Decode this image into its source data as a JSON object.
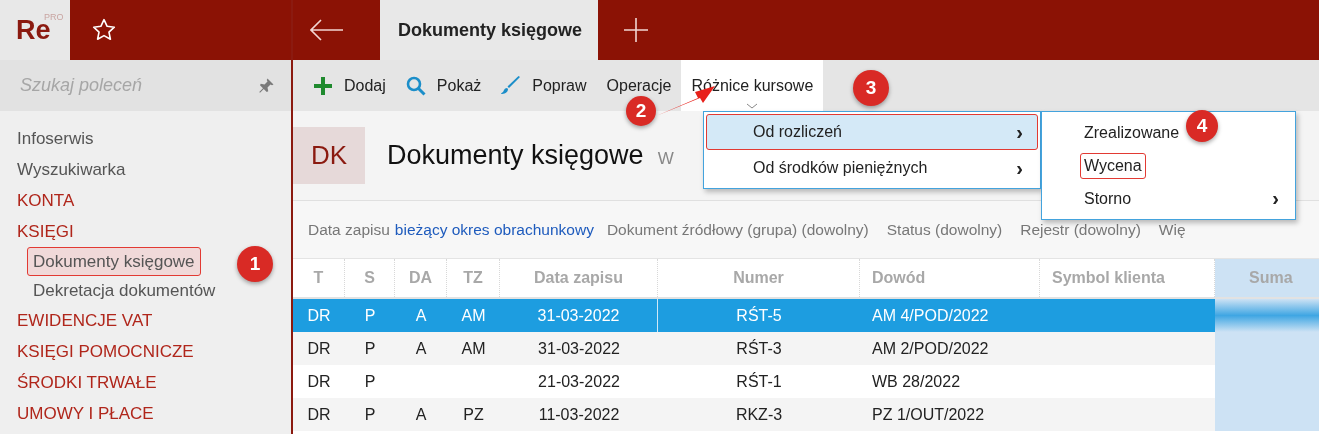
{
  "logo": {
    "text": "Re",
    "badge": "PRO"
  },
  "search": {
    "placeholder": "Szukaj poleceń"
  },
  "sidebar": {
    "items": [
      {
        "label": "Infoserwis",
        "kind": "link"
      },
      {
        "label": "Wyszukiwarka",
        "kind": "link"
      },
      {
        "label": "KONTA",
        "kind": "section"
      },
      {
        "label": "KSIĘGI",
        "kind": "section",
        "children": [
          {
            "label": "Dokumenty księgowe",
            "selected": true,
            "highlighted": true
          },
          {
            "label": "Dekretacja dokumentów",
            "selected": false,
            "highlighted": false
          }
        ]
      },
      {
        "label": "EWIDENCJE VAT",
        "kind": "section"
      },
      {
        "label": "KSIĘGI POMOCNICZE",
        "kind": "section"
      },
      {
        "label": "ŚRODKI TRWAŁE",
        "kind": "section"
      },
      {
        "label": "UMOWY I PŁACE",
        "kind": "section"
      }
    ]
  },
  "tabs": [
    {
      "label": "Dokumenty księgowe",
      "selected": true
    }
  ],
  "toolbar": [
    {
      "label": "Dodaj",
      "open": false
    },
    {
      "label": "Pokaż",
      "open": false
    },
    {
      "label": "Popraw",
      "open": false
    },
    {
      "label": "Operacje",
      "open": false
    },
    {
      "label": "Różnice kursowe",
      "open": true
    }
  ],
  "header": {
    "badge": "DK",
    "title": "Dokumenty księgowe",
    "subtitle": "W"
  },
  "filters": [
    {
      "label": "Data zapisu",
      "value": "bieżący okres obrachunkowy"
    },
    {
      "label": "Dokument źródłowy (grupa) (dowolny)"
    },
    {
      "label": "Status (dowolny)"
    },
    {
      "label": "Rejestr (dowolny)"
    },
    {
      "label": "Wię"
    }
  ],
  "table": {
    "columns": [
      "T",
      "S",
      "DA",
      "TZ",
      "Data zapisu",
      "Numer",
      "Dowód",
      "Symbol klienta",
      "Suma"
    ],
    "rows": [
      {
        "selected": true,
        "cells": [
          "DR",
          "P",
          "A",
          "AM",
          "31-03-2022",
          "RŚT-5",
          "AM 4/POD/2022"
        ]
      },
      {
        "selected": false,
        "cells": [
          "DR",
          "P",
          "A",
          "AM",
          "31-03-2022",
          "RŚT-3",
          "AM 2/POD/2022"
        ]
      },
      {
        "selected": false,
        "cells": [
          "DR",
          "P",
          "",
          "",
          "21-03-2022",
          "RŚT-1",
          "WB 28/2022"
        ]
      },
      {
        "selected": false,
        "cells": [
          "DR",
          "P",
          "A",
          "PZ",
          "11-03-2022",
          "RKZ-3",
          "PZ 1/OUT/2022"
        ]
      }
    ]
  },
  "menu": {
    "items": [
      {
        "label": "Od rozliczeń",
        "selected": true,
        "highlighted": true,
        "submenu": "›"
      },
      {
        "label": "Od środków pieniężnych",
        "selected": false,
        "highlighted": false,
        "submenu": "›"
      }
    ]
  },
  "submenu": {
    "items": [
      {
        "label": "Zrealizowane",
        "highlighted": false
      },
      {
        "label": "Wycena",
        "highlighted": true
      },
      {
        "label": "Storno",
        "highlighted": false,
        "submenu": "›"
      }
    ]
  },
  "callouts": [
    {
      "label": "1"
    },
    {
      "label": "2"
    },
    {
      "label": "3"
    },
    {
      "label": "4"
    }
  ]
}
